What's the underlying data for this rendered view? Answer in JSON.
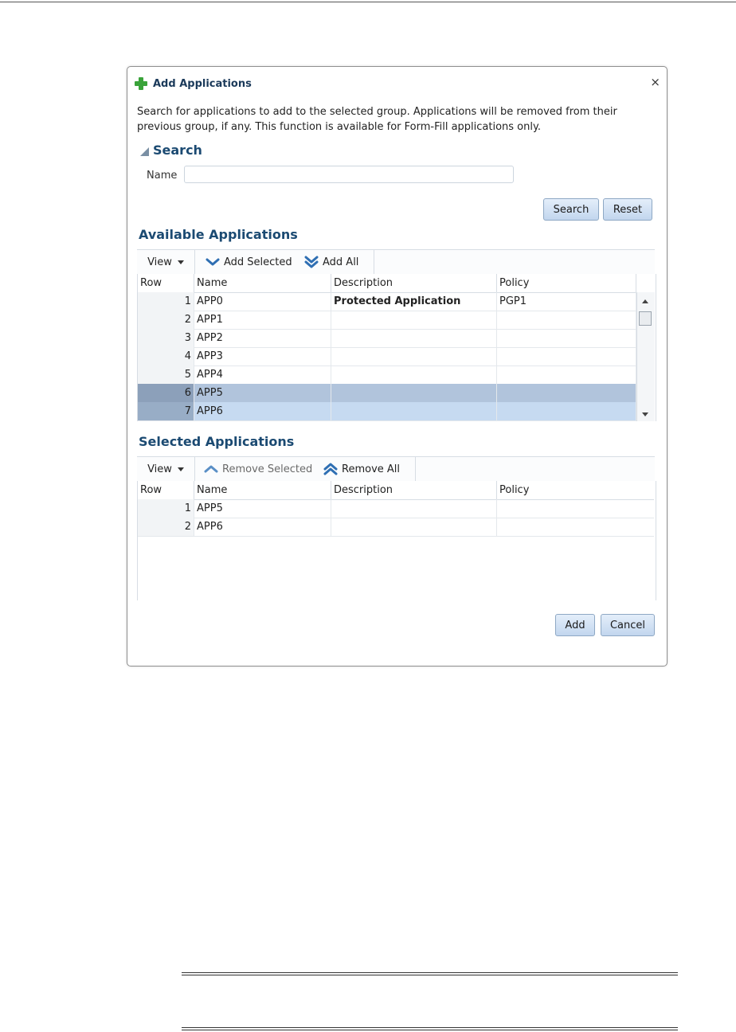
{
  "dialog": {
    "title": "Add Applications",
    "close": "×",
    "description": "Search for applications to add to the selected group. Applications will be removed from their previous group, if any. This function is available for Form-Fill applications only."
  },
  "search": {
    "heading": "Search",
    "name_label": "Name",
    "name_value": "",
    "search_button": "Search",
    "reset_button": "Reset"
  },
  "available": {
    "heading": "Available Applications",
    "toolbar": {
      "view": "View",
      "add_selected": "Add Selected",
      "add_all": "Add All"
    },
    "columns": [
      "Row",
      "Name",
      "Description",
      "Policy"
    ],
    "rows": [
      {
        "row": "1",
        "name": "APP0",
        "description": "Protected Application",
        "policy": "PGP1"
      },
      {
        "row": "2",
        "name": "APP1",
        "description": "",
        "policy": ""
      },
      {
        "row": "3",
        "name": "APP2",
        "description": "",
        "policy": ""
      },
      {
        "row": "4",
        "name": "APP3",
        "description": "",
        "policy": ""
      },
      {
        "row": "5",
        "name": "APP4",
        "description": "",
        "policy": ""
      },
      {
        "row": "6",
        "name": "APP5",
        "description": "",
        "policy": ""
      },
      {
        "row": "7",
        "name": "APP6",
        "description": "",
        "policy": ""
      }
    ]
  },
  "selected": {
    "heading": "Selected Applications",
    "toolbar": {
      "view": "View",
      "remove_selected": "Remove Selected",
      "remove_all": "Remove All"
    },
    "columns": [
      "Row",
      "Name",
      "Description",
      "Policy"
    ],
    "rows": [
      {
        "row": "1",
        "name": "APP5",
        "description": "",
        "policy": ""
      },
      {
        "row": "2",
        "name": "APP6",
        "description": "",
        "policy": ""
      }
    ]
  },
  "footer": {
    "add_button": "Add",
    "cancel_button": "Cancel"
  },
  "colors": {
    "heading": "#1b4a72",
    "selected_row": "#b1c4dc",
    "button": "#c2d6ee",
    "add_icon": "#3aa33a"
  }
}
